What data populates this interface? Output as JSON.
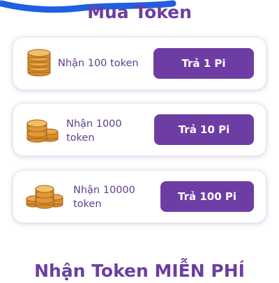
{
  "buy_section": {
    "title": "Mua Token",
    "offers": [
      {
        "label": "Nhận 100 token",
        "button": "Trả 1 Pi"
      },
      {
        "label": "Nhận 1000 token",
        "button": "Trả 10 Pi"
      },
      {
        "label": "Nhận 10000 token",
        "button": "Trả 100 Pi"
      }
    ]
  },
  "free_section": {
    "title": "Nhận Token MIỄN PHÍ"
  },
  "colors": {
    "accent": "#6d3da4",
    "title": "#6b3fa0",
    "scribble": "#1f5fe0",
    "coin": "#e9a43c"
  },
  "icons": {
    "coin_stack": "coin-stack-icon"
  }
}
